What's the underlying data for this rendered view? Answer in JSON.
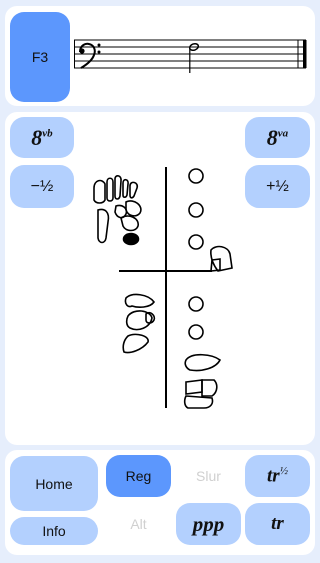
{
  "note_button": {
    "label": "F3"
  },
  "staff": {
    "clef": "bass",
    "note": "F3",
    "duration": "half"
  },
  "octave_down": {
    "main": "8",
    "sup": "vb"
  },
  "octave_up": {
    "main": "8",
    "sup": "va"
  },
  "semitone_down": {
    "label": "−½"
  },
  "semitone_up": {
    "label": "+½"
  },
  "fingering_chart": {
    "instrument_diagram": "bassoon-keywork"
  },
  "bottom": {
    "home": "Home",
    "info": "Info",
    "reg": "Reg",
    "slur": "Slur",
    "alt": "Alt",
    "ppp": "ppp",
    "trill_half": {
      "main": "tr",
      "sup": "½"
    },
    "trill": "tr"
  },
  "colors": {
    "accent": "#5c97fd",
    "button": "#b3d0fe",
    "background": "#e6eefc"
  }
}
